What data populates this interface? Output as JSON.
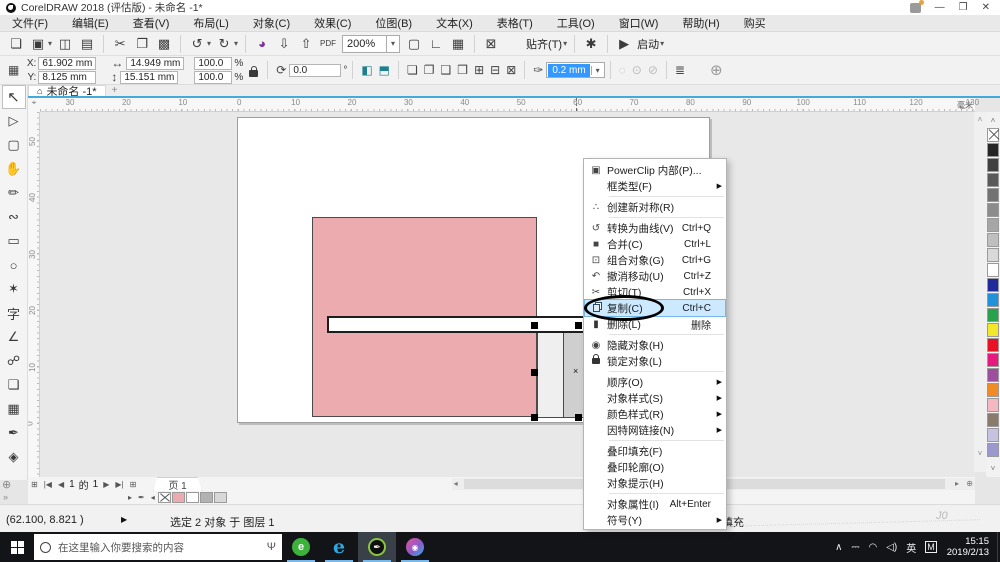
{
  "window": {
    "title": "CorelDRAW 2018 (评估版) - 未命名 -1*"
  },
  "menubar": [
    "文件(F)",
    "编辑(E)",
    "查看(V)",
    "布局(L)",
    "对象(C)",
    "效果(C)",
    "位图(B)",
    "文本(X)",
    "表格(T)",
    "工具(O)",
    "窗口(W)",
    "帮助(H)",
    "购买"
  ],
  "toolbar": {
    "zoom_value": "200%",
    "snap_label": "贴齐(T)",
    "launch_label": "启动",
    "buttons": [
      {
        "name": "new-document",
        "glyph": "❏"
      },
      {
        "name": "open",
        "glyph": "▣",
        "caret": true
      },
      {
        "name": "save",
        "glyph": "◫"
      },
      {
        "name": "print",
        "glyph": "▤"
      },
      {
        "name": "sep"
      },
      {
        "name": "cut",
        "glyph": "✂"
      },
      {
        "name": "copy",
        "glyph": "❐"
      },
      {
        "name": "paste",
        "glyph": "▩"
      },
      {
        "name": "sep"
      },
      {
        "name": "undo",
        "glyph": "↺",
        "caret": true
      },
      {
        "name": "redo",
        "glyph": "↻",
        "caret": true
      },
      {
        "name": "sep"
      },
      {
        "name": "search-content",
        "glyph": "◕",
        "purple": true
      },
      {
        "name": "import",
        "glyph": "⇩"
      },
      {
        "name": "export",
        "glyph": "⇧"
      },
      {
        "name": "publish-pdf",
        "glyph": "PDF",
        "small": true
      },
      {
        "name": "zoom-combo"
      },
      {
        "name": "full-screen-preview",
        "glyph": "▢"
      },
      {
        "name": "show-rulers",
        "glyph": "∟"
      },
      {
        "name": "show-grid",
        "glyph": "▦"
      },
      {
        "name": "sep"
      },
      {
        "name": "snap-toggle",
        "glyph": "⊠"
      },
      {
        "name": "snap-menu",
        "label": true,
        "caret": true
      },
      {
        "name": "sep"
      },
      {
        "name": "options",
        "glyph": "✱"
      },
      {
        "name": "sep"
      },
      {
        "name": "launch",
        "glyph": "▶",
        "label2": true,
        "caret": true
      }
    ]
  },
  "propbar": {
    "x_label": "X:",
    "x_value": "61.902 mm",
    "y_label": "Y:",
    "y_value": "8.125 mm",
    "width_value": "14.949 mm",
    "height_value": "15.151 mm",
    "scale_x": "100.0",
    "scale_y": "100.0",
    "percent": "%",
    "rotation_value": "0.0",
    "degree": "°",
    "outline_width": "0.2 mm",
    "shaping_glyphs": [
      "❏",
      "❐",
      "❑",
      "❒",
      "⊞",
      "⊟",
      "⊠"
    ]
  },
  "doc_tab": {
    "label": "未命名 -1*"
  },
  "ruler": {
    "h_labels": [
      "30",
      "20",
      "10",
      "0",
      "10",
      "20",
      "30",
      "40",
      "50",
      "60",
      "70",
      "80",
      "90",
      "100",
      "110",
      "120",
      "130"
    ],
    "h_start": 30,
    "h_step": 56.4,
    "v_labels": [
      "50",
      "40",
      "30",
      "20",
      "10",
      "0"
    ],
    "unit": "毫米"
  },
  "toolbox": [
    {
      "name": "pick-tool",
      "glyph": "↖",
      "active": true
    },
    {
      "name": "shape-tool",
      "glyph": "▷"
    },
    {
      "name": "crop-tool",
      "glyph": "▢"
    },
    {
      "name": "pan-tool",
      "glyph": "✋"
    },
    {
      "name": "freehand-tool",
      "glyph": "✏"
    },
    {
      "name": "curve-tool",
      "glyph": "∾"
    },
    {
      "name": "rectangle-tool",
      "glyph": "▭"
    },
    {
      "name": "ellipse-tool",
      "glyph": "○"
    },
    {
      "name": "polygon-tool",
      "glyph": "✶"
    },
    {
      "name": "text-tool",
      "glyph": "字"
    },
    {
      "name": "dimension-tool",
      "glyph": "∠"
    },
    {
      "name": "connector-tool",
      "glyph": "☍"
    },
    {
      "name": "shadow-tool",
      "glyph": "❏"
    },
    {
      "name": "mesh-fill-tool",
      "glyph": "▦"
    },
    {
      "name": "eyedropper-tool",
      "glyph": "✒"
    },
    {
      "name": "smart-fill-tool",
      "glyph": "◈"
    }
  ],
  "palette": [
    "none",
    "#262626",
    "#404040",
    "#595959",
    "#737373",
    "#8c8c8c",
    "#a6a6a6",
    "#bfbfbf",
    "#d9d9d9",
    "#ffffff",
    "#1f2b9b",
    "#2191d9",
    "#2aa24c",
    "#f3e72a",
    "#e81224",
    "#e5197e",
    "#9c4f9e",
    "#f38b24",
    "#f3b8c2",
    "#8a7a6b",
    "#c6c2e2",
    "#9b97cf"
  ],
  "context_menu": {
    "items": [
      {
        "icon": "powerclip",
        "glyph": "▣",
        "label": "PowerClip 内部(P)..."
      },
      {
        "icon": "",
        "label": "框类型(F)",
        "submenu": true,
        "sep_after": true
      },
      {
        "icon": "symmetry",
        "glyph": "∴",
        "label": "创建新对称(R)",
        "sep_after": true
      },
      {
        "icon": "to-curves",
        "glyph": "↺",
        "label": "转换为曲线(V)",
        "shortcut": "Ctrl+Q"
      },
      {
        "icon": "combine",
        "glyph": "■",
        "label": "合并(C)",
        "shortcut": "Ctrl+L"
      },
      {
        "icon": "group",
        "glyph": "⊡",
        "label": "组合对象(G)",
        "shortcut": "Ctrl+G"
      },
      {
        "icon": "undo-move",
        "glyph": "↶",
        "label": "撤消移动(U)",
        "shortcut": "Ctrl+Z"
      },
      {
        "icon": "cut",
        "glyph": "✂",
        "label": "剪切(T)",
        "shortcut": "Ctrl+X"
      },
      {
        "icon": "copy",
        "glyph": "css-copy",
        "label": "复制(C)",
        "shortcut": "Ctrl+C",
        "highlight": true
      },
      {
        "icon": "delete",
        "glyph": "▮",
        "label": "删除(L)",
        "shortcut": "删除",
        "sep_after": true
      },
      {
        "icon": "hide",
        "glyph": "◉",
        "label": "隐藏对象(H)"
      },
      {
        "icon": "lock",
        "glyph": "css-lock",
        "label": "锁定对象(L)",
        "sep_after": true
      },
      {
        "icon": "",
        "label": "顺序(O)",
        "submenu": true
      },
      {
        "icon": "",
        "label": "对象样式(S)",
        "submenu": true
      },
      {
        "icon": "",
        "label": "颜色样式(R)",
        "submenu": true
      },
      {
        "icon": "",
        "label": "因特网链接(N)",
        "submenu": true,
        "sep_after": true
      },
      {
        "icon": "",
        "label": "叠印填充(F)"
      },
      {
        "icon": "",
        "label": "叠印轮廓(O)"
      },
      {
        "icon": "",
        "label": "对象提示(H)",
        "sep_after": true
      },
      {
        "icon": "",
        "label": "对象属性(I)",
        "shortcut": "Alt+Enter"
      },
      {
        "icon": "",
        "label": "符号(Y)",
        "submenu": true
      }
    ]
  },
  "page_nav": {
    "first": "⊞",
    "begin": "|◀",
    "prev": "◀",
    "current": "1",
    "of": "的",
    "total": "1",
    "next": "▶",
    "end": "▶|",
    "last": "⊞",
    "tab": "页 1"
  },
  "doc_palette": [
    "none",
    "#ecabae",
    "#ffffff",
    "#b2b2b2",
    "#d8d8d8"
  ],
  "statusbar": {
    "coords": "(62.100, 8.821 )",
    "flyout": "▶",
    "selection": "选定 2 对象 于 图层 1",
    "fill_label": "填充",
    "watermark": "J0"
  },
  "taskbar": {
    "search_placeholder": "在这里输入你要搜索的内容",
    "apps": [
      {
        "name": "browser-360",
        "glyph": "e"
      },
      {
        "name": "edge",
        "glyph": "e"
      },
      {
        "name": "coreldraw",
        "glyph": "✒",
        "active": true
      },
      {
        "name": "photo-paint",
        "glyph": "◉"
      }
    ],
    "tray": [
      "∧",
      "⎓",
      "◠",
      "◁)",
      "英",
      "M"
    ],
    "time": "15:15",
    "date": "2019/2/13"
  },
  "glyphs": {
    "caret": "▾",
    "submenu": "▶",
    "home": "⌂",
    "plus": "+",
    "min": "—",
    "restore": "❐",
    "close": "✕",
    "origin": "⌖",
    "mic": "Ψ",
    "left": "◂",
    "right": "▸",
    "up": "˄",
    "down": "˅",
    "zoom_sb": "⊕",
    "x_sel": "×",
    "lock_pb": "",
    "percent": "%"
  }
}
